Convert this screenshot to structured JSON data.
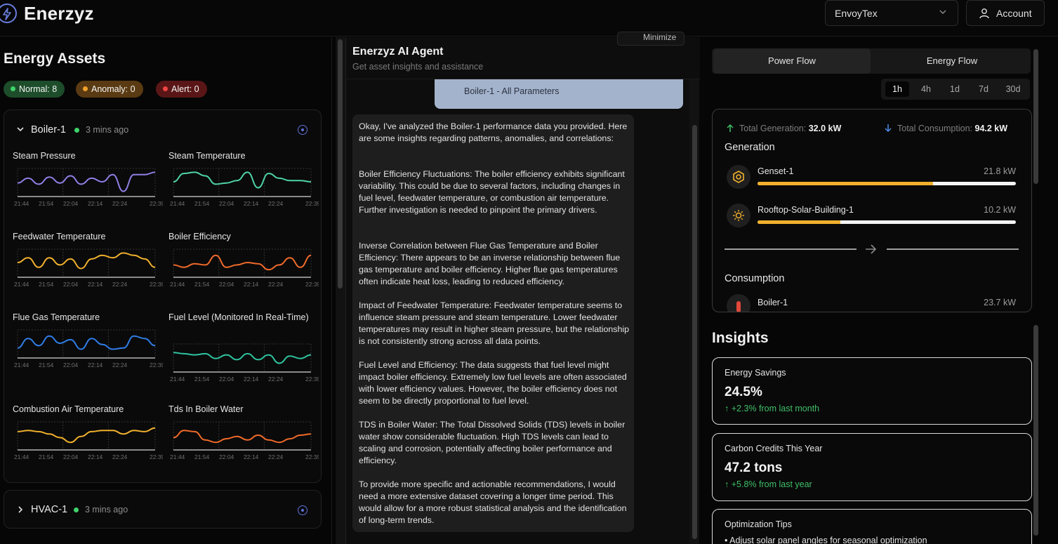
{
  "app": {
    "name": "Enerzyz"
  },
  "header": {
    "org_selected": "EnvoyTex",
    "account_label": "Account"
  },
  "assets_panel": {
    "title": "Energy Assets",
    "badges": {
      "normal": "Normal: 8",
      "anomaly": "Anomaly: 0",
      "alert": "Alert: 0"
    },
    "assets": [
      {
        "name": "Boiler-1",
        "status": "normal",
        "updated": "3 mins ago",
        "expanded": true,
        "charts": [
          {
            "label": "Steam Pressure",
            "color": "#8f7fe6",
            "points": [
              0.55,
              0.35,
              0.6,
              0.3,
              0.55,
              0.25,
              0.6,
              0.35,
              0.5,
              0.2,
              0.9,
              0.2,
              0.2,
              0.1
            ]
          },
          {
            "label": "Steam Temperature",
            "color": "#4ed4a8",
            "points": [
              0.5,
              0.15,
              0.1,
              0.25,
              0.6,
              0.55,
              0.45,
              0.1,
              0.75,
              0.15,
              0.35,
              0.45,
              0.45,
              0.5
            ]
          },
          {
            "label": "Feedwater Temperature",
            "color": "#f1b12d",
            "points": [
              0.5,
              0.3,
              0.7,
              0.3,
              0.6,
              0.35,
              0.75,
              0.35,
              0.2,
              0.3,
              0.1,
              0.2,
              0.35,
              0.7
            ]
          },
          {
            "label": "Boiler Efficiency",
            "color": "#f06a2a",
            "points": [
              0.6,
              0.7,
              0.55,
              0.6,
              0.2,
              0.7,
              0.6,
              0.5,
              0.55,
              0.8,
              0.6,
              0.3,
              0.7,
              0.2
            ]
          },
          {
            "label": "Flue Gas Temperature",
            "color": "#2f7de6",
            "points": [
              0.7,
              0.3,
              0.6,
              0.2,
              0.5,
              0.35,
              0.75,
              0.3,
              0.55,
              0.75,
              0.7,
              0.2,
              0.3,
              0.6
            ]
          },
          {
            "label": "Fuel Level (Monitored In Real-Time)",
            "color": "#2ec4a0",
            "points": [
              0.3,
              0.35,
              0.4,
              0.35,
              0.55,
              0.4,
              0.6,
              0.35,
              0.6,
              0.4,
              0.75,
              0.45,
              0.55,
              0.4
            ]
          },
          {
            "label": "Combustion Air Temperature",
            "color": "#f1b12d",
            "points": [
              0.35,
              0.3,
              0.35,
              0.45,
              0.6,
              0.8,
              0.55,
              0.35,
              0.3,
              0.3,
              0.45,
              0.3,
              0.35,
              0.2
            ]
          },
          {
            "label": "Tds In Boiler Water",
            "color": "#f06a2a",
            "points": [
              0.6,
              0.3,
              0.35,
              0.7,
              0.8,
              0.65,
              0.55,
              0.7,
              0.5,
              0.7,
              0.8,
              0.65,
              0.5,
              0.45
            ]
          }
        ],
        "time_ticks": [
          "21:44",
          "21:54",
          "22:04",
          "22:14",
          "22:24",
          "22:39"
        ]
      },
      {
        "name": "HVAC-1",
        "status": "normal",
        "updated": "3 mins ago",
        "expanded": false
      }
    ]
  },
  "agent": {
    "minimize_label": "Minimize",
    "title": "Enerzyz AI Agent",
    "subtitle": "Get asset insights and assistance",
    "user_message": "Boiler-1 - All Parameters",
    "response": [
      "Okay, I've analyzed the Boiler-1 performance data you provided. Here are some insights regarding patterns, anomalies, and correlations:",
      "Boiler Efficiency Fluctuations: The boiler efficiency exhibits significant variability. This could be due to several factors, including changes in fuel level, feedwater temperature, or combustion air temperature. Further investigation is needed to pinpoint the primary drivers.",
      "Inverse Correlation between Flue Gas Temperature and Boiler Efficiency: There appears to be an inverse relationship between flue gas temperature and boiler efficiency. Higher flue gas temperatures often indicate heat loss, leading to reduced efficiency.",
      "Impact of Feedwater Temperature: Feedwater temperature seems to influence steam pressure and steam temperature. Lower feedwater temperatures may result in higher steam pressure, but the relationship is not consistently strong across all data points.",
      "Fuel Level and Efficiency: The data suggests that fuel level might impact boiler efficiency. Extremely low fuel levels are often associated with lower efficiency values. However, the boiler efficiency does not seem to be directly proportional to fuel level.",
      "TDS in Boiler Water: The Total Dissolved Solids (TDS) levels in boiler water show considerable fluctuation. High TDS levels can lead to scaling and corrosion, potentially affecting boiler performance and efficiency.",
      "To provide more specific and actionable recommendations, I would need a more extensive dataset covering a longer time period. This would allow for a more robust statistical analysis and the identification of long-term trends."
    ]
  },
  "flow": {
    "tabs": [
      "Power Flow",
      "Energy Flow"
    ],
    "active_tab": "Power Flow",
    "ranges": [
      "1h",
      "4h",
      "1d",
      "7d",
      "30d"
    ],
    "active_range": "1h",
    "total_generation_label": "Total Generation:",
    "total_generation_value": "32.0 kW",
    "total_consumption_label": "Total Consumption:",
    "total_consumption_value": "94.2 kW",
    "generation_label": "Generation",
    "consumption_label": "Consumption",
    "generation": [
      {
        "name": "Genset-1",
        "value": "21.8 kW",
        "fill": 0.68,
        "icon": "hexagon-icon"
      },
      {
        "name": "Rooftop-Solar-Building-1",
        "value": "10.2 kW",
        "fill": 0.32,
        "icon": "sun-icon"
      }
    ],
    "consumption": [
      {
        "name": "Boiler-1",
        "value": "23.7 kW",
        "icon": "boiler-icon"
      }
    ],
    "accent_color": "#f1b12d"
  },
  "insights": {
    "title": "Insights",
    "cards": [
      {
        "label": "Energy Savings",
        "value": "24.5%",
        "change": "↑ +2.3% from last month"
      },
      {
        "label": "Carbon Credits This Year",
        "value": "47.2 tons",
        "change": "↑ +5.8% from last year"
      },
      {
        "label": "Optimization Tips",
        "tip": "• Adjust solar panel angles for seasonal optimization"
      }
    ]
  }
}
